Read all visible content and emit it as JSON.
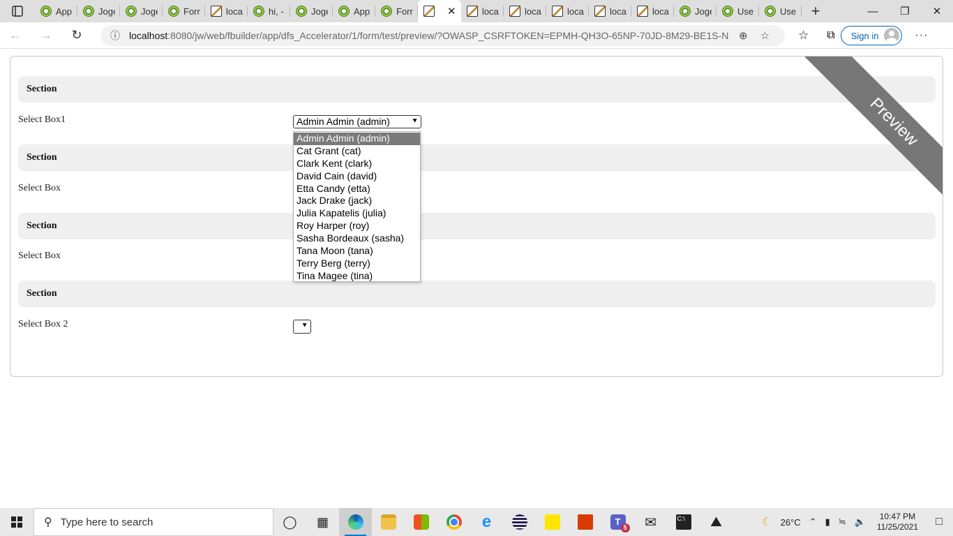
{
  "browser": {
    "tabs": [
      {
        "label": "App",
        "icon": "joget-globe-icon"
      },
      {
        "label": "Joge",
        "icon": "joget-globe-icon"
      },
      {
        "label": "Joge",
        "icon": "joget-globe-icon"
      },
      {
        "label": "Form",
        "icon": "joget-globe-icon"
      },
      {
        "label": "local",
        "icon": "page-icon"
      },
      {
        "label": "hi, -",
        "icon": "joget-globe-icon"
      },
      {
        "label": "Joge",
        "icon": "joget-globe-icon"
      },
      {
        "label": "App",
        "icon": "joget-globe-icon"
      },
      {
        "label": "Form",
        "icon": "joget-globe-icon"
      },
      {
        "label": "",
        "icon": "page-icon",
        "active": true
      },
      {
        "label": "local",
        "icon": "page-icon"
      },
      {
        "label": "local",
        "icon": "page-icon"
      },
      {
        "label": "local",
        "icon": "page-icon"
      },
      {
        "label": "local",
        "icon": "page-icon"
      },
      {
        "label": "local",
        "icon": "page-icon"
      },
      {
        "label": "Joge",
        "icon": "joget-globe-icon"
      },
      {
        "label": "User",
        "icon": "joget-globe-icon"
      },
      {
        "label": "User",
        "icon": "joget-globe-icon"
      }
    ],
    "url_host": "localhost",
    "url_path": ":8080/jw/web/fbuilder/app/dfs_Accelerator/1/form/test/preview/?OWASP_CSRFTOKEN=EPMH-QH3O-65NP-70JD-8M29-BE1S-N...",
    "signin_label": "Sign in"
  },
  "form": {
    "ribbon": "Preview",
    "sections": [
      {
        "title": "Section",
        "field_label": "Select Box1",
        "value": "Admin Admin (admin)"
      },
      {
        "title": "Section",
        "field_label": "Select Box",
        "value": ""
      },
      {
        "title": "Section",
        "field_label": "Select Box",
        "value": ""
      },
      {
        "title": "Section",
        "field_label": "Select Box 2",
        "value": ""
      }
    ],
    "dropdown_options": [
      "Admin Admin (admin)",
      "Cat Grant (cat)",
      "Clark Kent (clark)",
      "David Cain (david)",
      "Etta Candy (etta)",
      "Jack Drake (jack)",
      "Julia Kapatelis (julia)",
      "Roy Harper (roy)",
      "Sasha Bordeaux (sasha)",
      "Tana Moon (tana)",
      "Terry Berg (terry)",
      "Tina Magee (tina)"
    ],
    "selected_option_index": 0
  },
  "taskbar": {
    "search_placeholder": "Type here to search",
    "teams_badge": "5",
    "weather": "26°C",
    "time": "10:47 PM",
    "date": "11/25/2021"
  }
}
